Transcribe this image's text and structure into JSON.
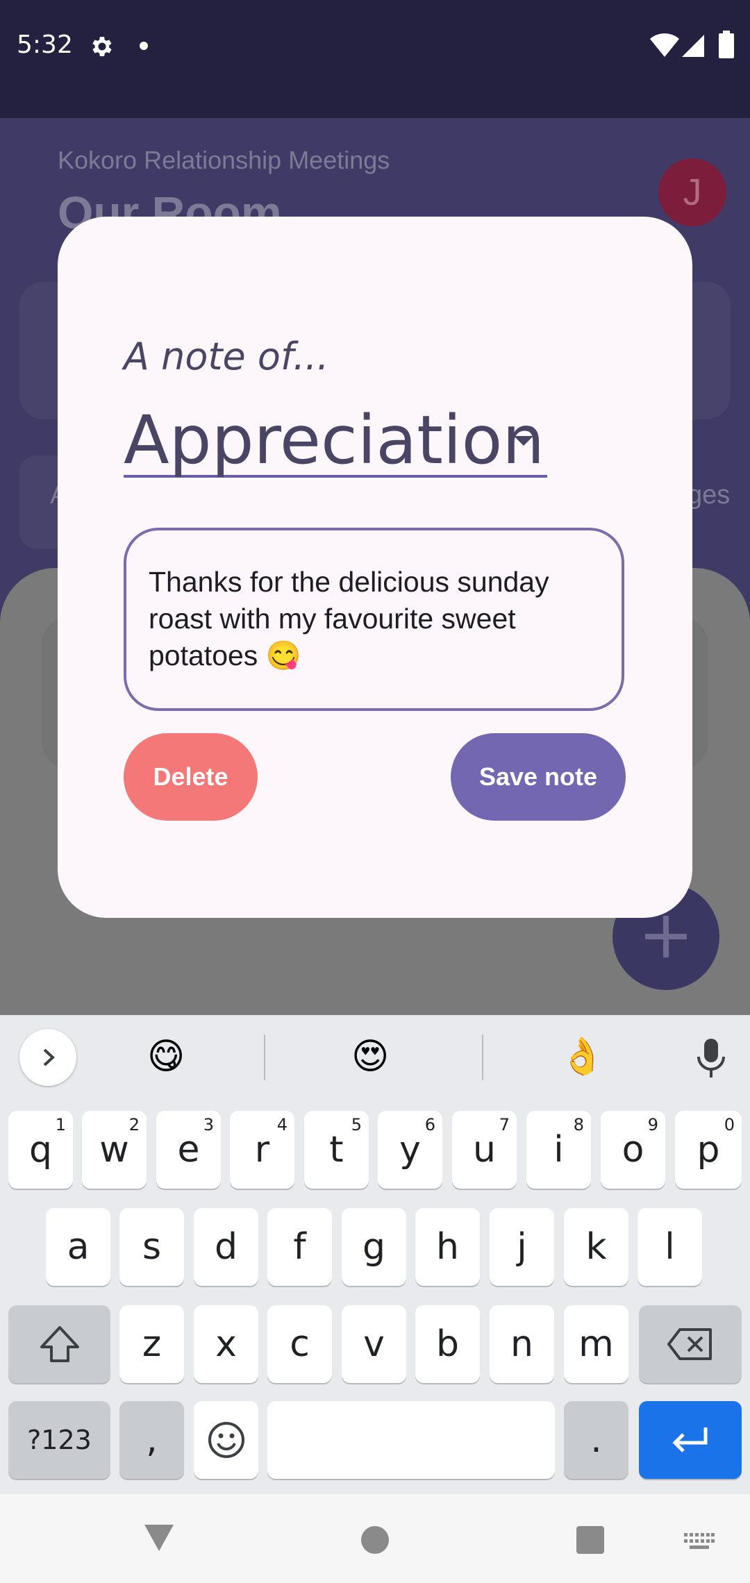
{
  "status_bar": {
    "time": "5:32",
    "icons": [
      "gear-icon",
      "dot-icon",
      "wifi-icon",
      "signal-icon",
      "battery-icon"
    ]
  },
  "app": {
    "subtitle": "Kokoro Relationship Meetings",
    "title": "Our Room",
    "avatar_initial": "J",
    "tab_left_fragment": "A",
    "tab_right_fragment": "ges"
  },
  "dialog": {
    "note_of_label": "A note of...",
    "category_value": "Appreciation",
    "note_text": "Thanks for the delicious sunday roast with my favourite sweet potatoes 😋",
    "delete_label": "Delete",
    "save_label": "Save note"
  },
  "keyboard": {
    "suggestions": [
      "😋",
      "😍",
      "👌"
    ],
    "row1": [
      {
        "key": "q",
        "hint": "1"
      },
      {
        "key": "w",
        "hint": "2"
      },
      {
        "key": "e",
        "hint": "3"
      },
      {
        "key": "r",
        "hint": "4"
      },
      {
        "key": "t",
        "hint": "5"
      },
      {
        "key": "y",
        "hint": "6"
      },
      {
        "key": "u",
        "hint": "7"
      },
      {
        "key": "i",
        "hint": "8"
      },
      {
        "key": "o",
        "hint": "9"
      },
      {
        "key": "p",
        "hint": "0"
      }
    ],
    "row2": [
      "a",
      "s",
      "d",
      "f",
      "g",
      "h",
      "j",
      "k",
      "l"
    ],
    "row3": [
      "z",
      "x",
      "c",
      "v",
      "b",
      "n",
      "m"
    ],
    "symbols_label": "?123",
    "comma": ",",
    "period": "."
  },
  "colors": {
    "accent": "#7267b0",
    "delete": "#f47878",
    "enter_key": "#1a73e8"
  }
}
